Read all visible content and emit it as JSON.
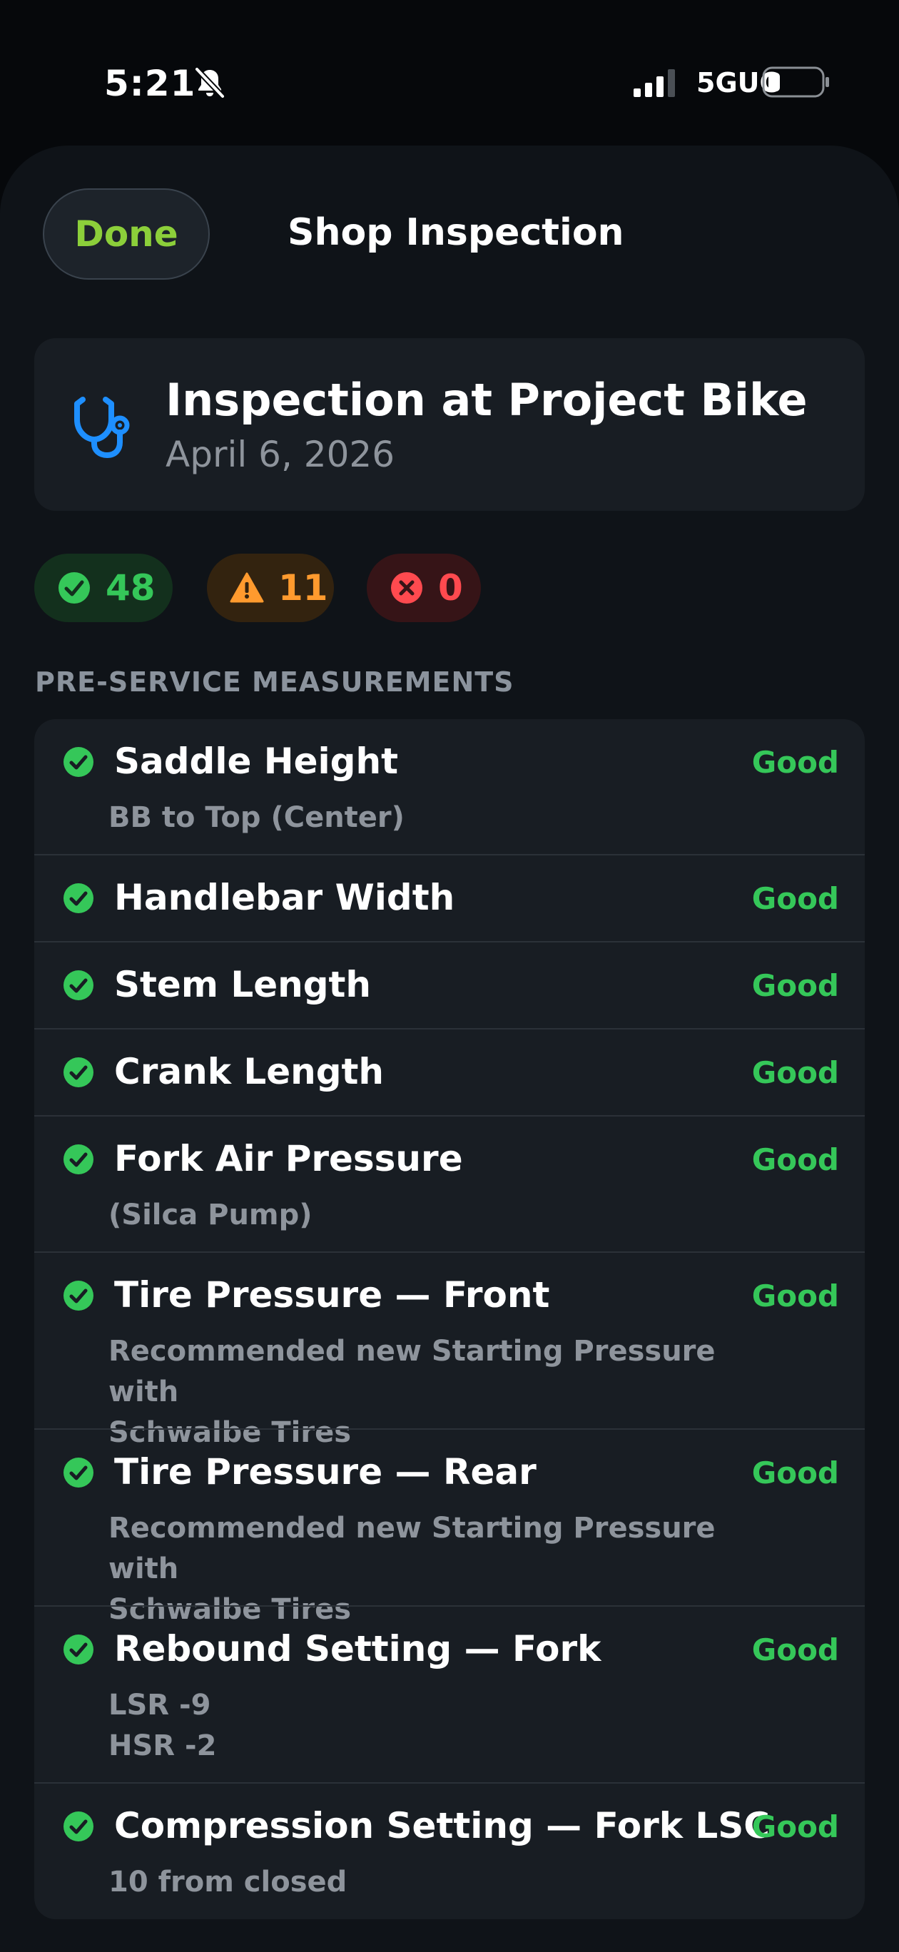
{
  "status_bar": {
    "time": "5:21",
    "network": "5GUC"
  },
  "header": {
    "done_label": "Done",
    "title": "Shop Inspection"
  },
  "inspection": {
    "title": "Inspection at Project Bike",
    "date": "April 6, 2026"
  },
  "summary": {
    "good_count": "48",
    "warn_count": "11",
    "fail_count": "0"
  },
  "section": {
    "title": "PRE-SERVICE MEASUREMENTS"
  },
  "items": [
    {
      "title": "Saddle Height",
      "status": "Good",
      "sub1": "BB to Top (Center)",
      "sub2": ""
    },
    {
      "title": "Handlebar Width",
      "status": "Good",
      "sub1": "",
      "sub2": ""
    },
    {
      "title": "Stem Length",
      "status": "Good",
      "sub1": "",
      "sub2": ""
    },
    {
      "title": "Crank Length",
      "status": "Good",
      "sub1": "",
      "sub2": ""
    },
    {
      "title": "Fork Air Pressure",
      "status": "Good",
      "sub1": "(Silca Pump)",
      "sub2": ""
    },
    {
      "title": "Tire Pressure — Front",
      "status": "Good",
      "sub1": "Recommended new Starting Pressure with",
      "sub2": "Schwalbe Tires"
    },
    {
      "title": "Tire Pressure — Rear",
      "status": "Good",
      "sub1": "Recommended new Starting Pressure with",
      "sub2": "Schwalbe Tires"
    },
    {
      "title": "Rebound Setting — Fork",
      "status": "Good",
      "sub1": "LSR -9",
      "sub2": "HSR -2"
    },
    {
      "title": "Compression Setting — Fork LSC",
      "status": "Good",
      "sub1": "10 from closed",
      "sub2": ""
    }
  ],
  "colors": {
    "good": "#35c759",
    "warn": "#ff9a2e",
    "fail": "#ff4a4f",
    "accent": "#8ccf3a",
    "icon_blue": "#1e8fff"
  },
  "icons": {
    "silent": "bell-slash-icon",
    "signal": "cellular-signal-icon",
    "battery": "battery-icon",
    "inspection": "stethoscope-icon",
    "good": "checkmark-circle-icon",
    "warn": "warning-triangle-icon",
    "fail": "x-circle-icon"
  }
}
